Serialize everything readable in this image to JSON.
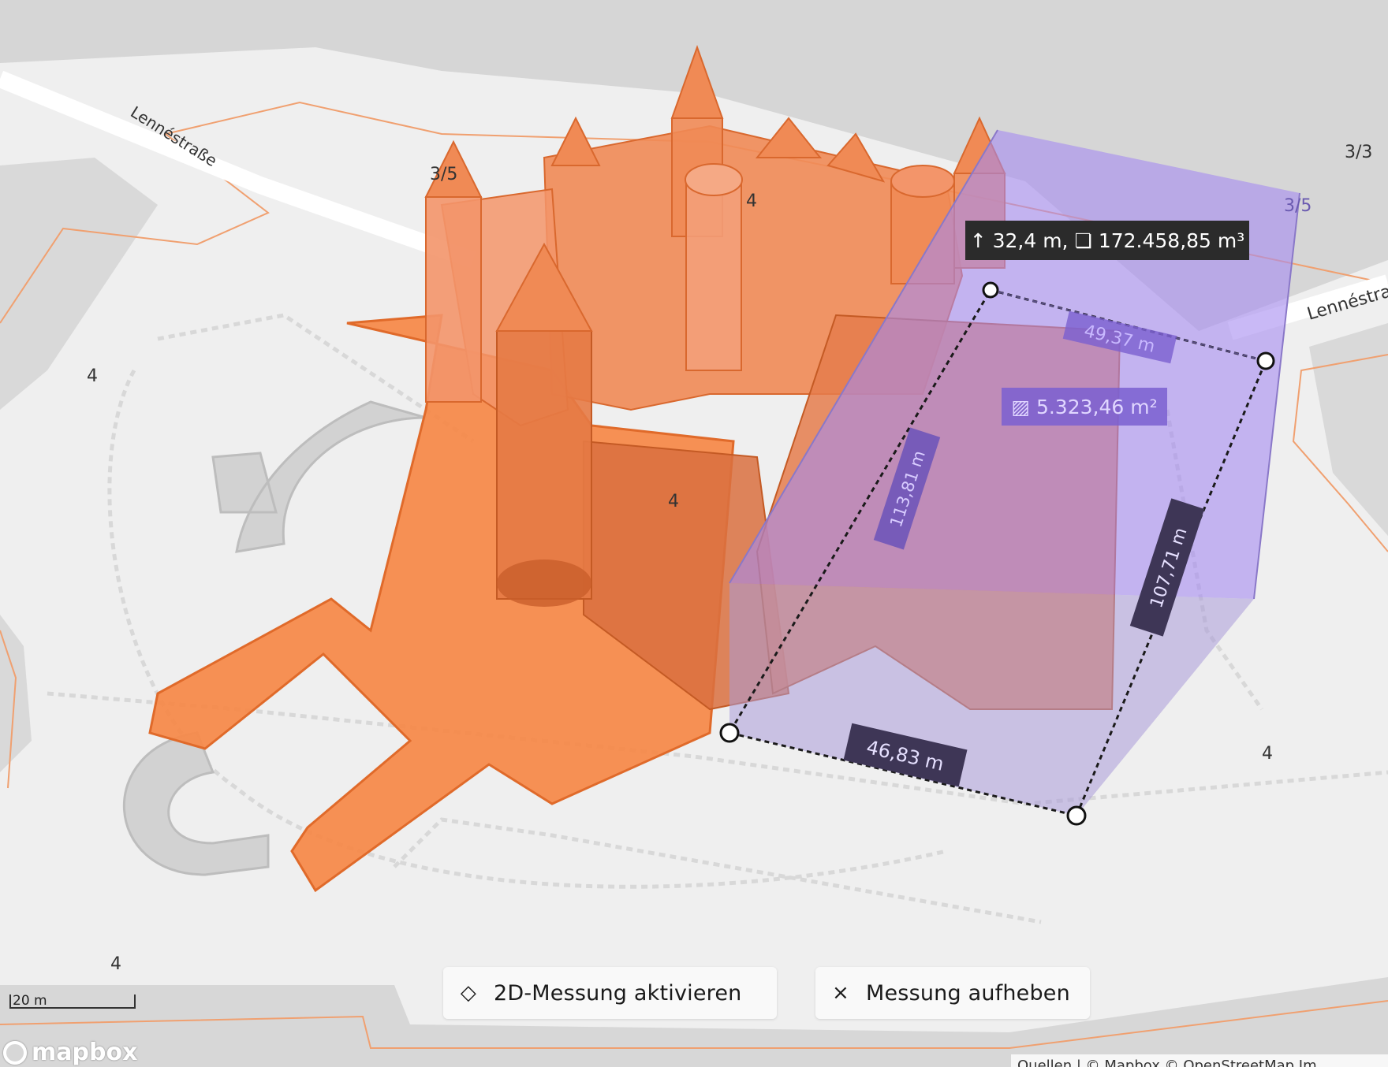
{
  "map": {
    "streets": [
      "Lennéstraße",
      "Lennéstra"
    ],
    "building_labels": [
      "3/5",
      "4",
      "3/5",
      "4",
      "4",
      "4",
      "4",
      "4",
      "3/3"
    ]
  },
  "measurement": {
    "height_volume": "32,4 m, ❏ 172.458,85 m³",
    "height_icon": "arrow-up-icon",
    "area": "▨ 5.323,46 m²",
    "edges": [
      "49,37 m",
      "113,81 m",
      "107,71 m",
      "46,83 m"
    ]
  },
  "controls": {
    "activate_2d": "2D-Messung aktivieren",
    "activate_2d_icon": "diamond-outline-icon",
    "clear": "Messung aufheben",
    "clear_icon": "close-icon"
  },
  "scale": {
    "label": "20 m"
  },
  "branding": {
    "logo_text": "mapbox"
  },
  "attribution": "Quellen | © Mapbox © OpenStreetMap Im",
  "colors": {
    "building": "#f58a4b",
    "building_dark": "#d9682e",
    "measure_fill": "#a58af0",
    "label_bg": "#3e3656",
    "road": "#ffffff",
    "ground": "#efefef",
    "water": "#d4d4d4"
  }
}
